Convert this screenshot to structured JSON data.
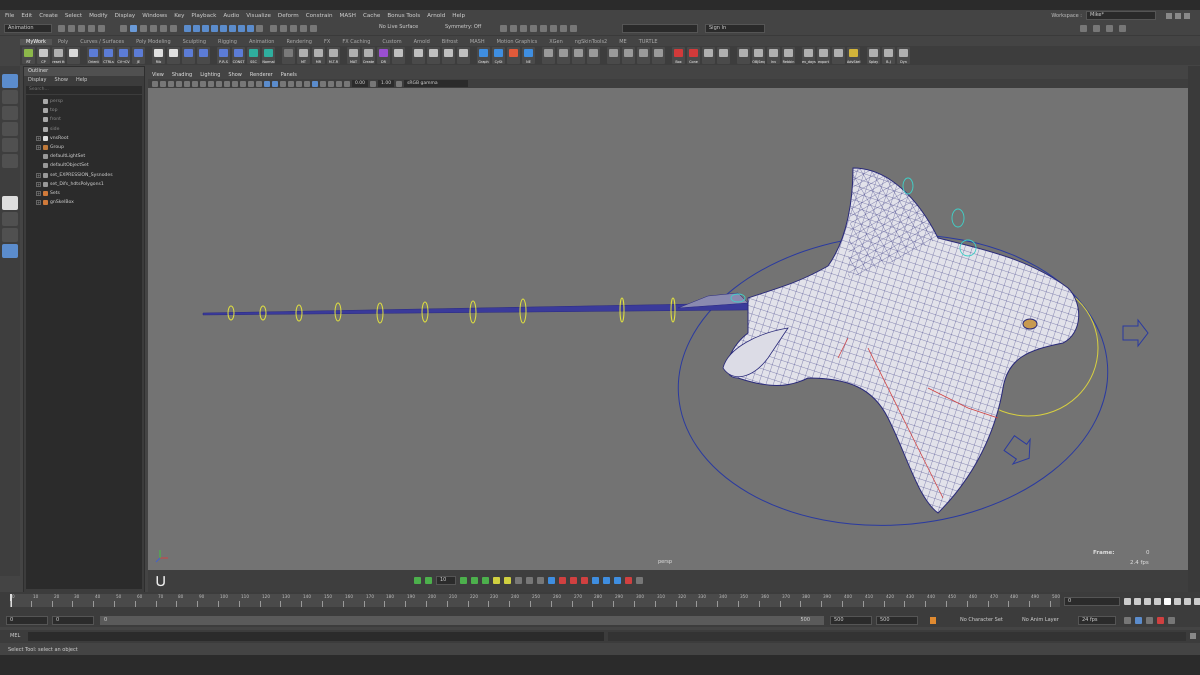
{
  "menubar": {
    "items": [
      "File",
      "Edit",
      "Create",
      "Select",
      "Modify",
      "Display",
      "Windows",
      "Key",
      "Playback",
      "Audio",
      "Visualize",
      "Deform",
      "Constrain",
      "MASH",
      "Cache",
      "Bonus Tools",
      "Arnold",
      "Help"
    ],
    "workspace_label": "Workspace :",
    "workspace_value": "Mike*"
  },
  "statusline": {
    "mode": "Animation",
    "live_surface": "No Live Surface",
    "symmetry": "Symmetry: Off",
    "sign_in": "Sign In"
  },
  "shelf": {
    "tabs": [
      "MyWork",
      "Poly",
      "Curves / Surfaces",
      "Poly Modeling",
      "Sculpting",
      "Rigging",
      "Animation",
      "Rendering",
      "FX",
      "FX Caching",
      "Custom",
      "Arnold",
      "Bifrost",
      "MASH",
      "Motion Graphics",
      "XGen",
      "ngSkinTools2",
      "ME",
      "TURTLE"
    ],
    "active_tab": "MyWork",
    "buttons": [
      {
        "label": "RT",
        "color": "#8cb84a"
      },
      {
        "label": "CP",
        "color": "#c8c8c8"
      },
      {
        "label": "reset tt",
        "color": "#b0b0b0"
      },
      {
        "label": "",
        "color": "#d9d9d9"
      },
      {
        "label": "Orient",
        "color": "#5c7cd6"
      },
      {
        "label": "CTRLs",
        "color": "#5c7cd6"
      },
      {
        "label": "CV→CV",
        "color": "#5c7cd6"
      },
      {
        "label": "JE",
        "color": "#5c7cd6"
      },
      {
        "label": "Rib",
        "color": "#e0e0e0"
      },
      {
        "label": "",
        "color": "#e0e0e0"
      },
      {
        "label": "",
        "color": "#5c7cd6"
      },
      {
        "label": "",
        "color": "#5c7cd6"
      },
      {
        "label": "P-R-S",
        "color": "#5c7cd6"
      },
      {
        "label": "CONST",
        "color": "#5c7cd6"
      },
      {
        "label": "SSC",
        "color": "#2fae9e"
      },
      {
        "label": "Normal",
        "color": "#2fae9e"
      },
      {
        "label": "",
        "color": "#7a7a7a"
      },
      {
        "label": "MT",
        "color": "#b0b0b0"
      },
      {
        "label": "MR",
        "color": "#b0b0b0"
      },
      {
        "label": "M-T-R",
        "color": "#b0b0b0"
      },
      {
        "label": "MAT",
        "color": "#b0b0b0"
      },
      {
        "label": "Create",
        "color": "#b0b0b0"
      },
      {
        "label": "DR",
        "color": "#9a4fd1"
      },
      {
        "label": "",
        "color": "#c0c0c0"
      },
      {
        "label": "",
        "color": "#c0c0c0"
      },
      {
        "label": "",
        "color": "#c0c0c0"
      },
      {
        "label": "",
        "color": "#c0c0c0"
      },
      {
        "label": "",
        "color": "#c0c0c0"
      },
      {
        "label": "Graph",
        "color": "#3f8ee0"
      },
      {
        "label": "CySt",
        "color": "#3f8ee0"
      },
      {
        "label": "",
        "color": "#e05a3a"
      },
      {
        "label": "NE",
        "color": "#3f8ee0"
      },
      {
        "label": "",
        "color": "#9a9a9a"
      },
      {
        "label": "",
        "color": "#9a9a9a"
      },
      {
        "label": "",
        "color": "#9a9a9a"
      },
      {
        "label": "",
        "color": "#9a9a9a"
      },
      {
        "label": "",
        "color": "#9a9a9a"
      },
      {
        "label": "",
        "color": "#9a9a9a"
      },
      {
        "label": "",
        "color": "#9a9a9a"
      },
      {
        "label": "",
        "color": "#9a9a9a"
      },
      {
        "label": "Box",
        "color": "#d23a3a"
      },
      {
        "label": "Cone",
        "color": "#d23a3a"
      },
      {
        "label": "",
        "color": "#b0b0b0"
      },
      {
        "label": "",
        "color": "#b0b0b0"
      },
      {
        "label": "",
        "color": "#b0b0b0"
      },
      {
        "label": "OBJSeq",
        "color": "#b0b0b0"
      },
      {
        "label": "Inv",
        "color": "#b0b0b0"
      },
      {
        "label": "Rebbin",
        "color": "#b0b0b0"
      },
      {
        "label": "ev_days",
        "color": "#b0b0b0"
      },
      {
        "label": "export",
        "color": "#b0b0b0"
      },
      {
        "label": "",
        "color": "#b0b0b0"
      },
      {
        "label": "AdvSkel",
        "color": "#d2b43a"
      },
      {
        "label": "Splay",
        "color": "#b0b0b0"
      },
      {
        "label": "B-J",
        "color": "#b0b0b0"
      },
      {
        "label": "Dyn",
        "color": "#b0b0b0"
      }
    ]
  },
  "outliner": {
    "title": "Outliner",
    "menu": [
      "Display",
      "Show",
      "Help"
    ],
    "search_placeholder": "Search...",
    "items": [
      {
        "label": "persp",
        "color": "#aaa",
        "exp": ""
      },
      {
        "label": "top",
        "color": "#aaa",
        "exp": ""
      },
      {
        "label": "front",
        "color": "#aaa",
        "exp": ""
      },
      {
        "label": "side",
        "color": "#aaa",
        "exp": ""
      },
      {
        "label": "vnsRoot",
        "color": "#ddd",
        "exp": "+"
      },
      {
        "label": "Group",
        "color": "#c07a3a",
        "exp": "+"
      },
      {
        "label": "defaultLightSet",
        "color": "#999",
        "exp": ""
      },
      {
        "label": "defaultObjectSet",
        "color": "#999",
        "exp": ""
      },
      {
        "label": "set_EXPRESSION_Sysnodes",
        "color": "#999",
        "exp": "+"
      },
      {
        "label": "set_Difs_hdtsPolygons1",
        "color": "#999",
        "exp": "+"
      },
      {
        "label": "Sets",
        "color": "#d07a3a",
        "exp": "+"
      },
      {
        "label": "gnSkelBox",
        "color": "#d07a3a",
        "exp": "+"
      }
    ]
  },
  "viewport": {
    "menu": [
      "View",
      "Shading",
      "Lighting",
      "Show",
      "Renderer",
      "Panels"
    ],
    "camera": "persp",
    "frame_label": "Frame:",
    "frame_value": "0",
    "fps": "2.4 fps",
    "field_1": "0.00",
    "field_2": "1.00",
    "colorspace": "sRGB gamma"
  },
  "timeline": {
    "ticks": [
      "0",
      "10",
      "20",
      "30",
      "40",
      "50",
      "60",
      "70",
      "80",
      "90",
      "100",
      "110",
      "120",
      "130",
      "140",
      "150",
      "160",
      "170",
      "180",
      "190",
      "200",
      "210",
      "220",
      "230",
      "240",
      "250",
      "260",
      "270",
      "280",
      "290",
      "300",
      "310",
      "320",
      "330",
      "340",
      "350",
      "360",
      "370",
      "380",
      "390",
      "400",
      "410",
      "420",
      "430",
      "440",
      "450",
      "460",
      "470",
      "480",
      "490",
      "500"
    ],
    "current_frame": "0",
    "range_start": "0",
    "range_start2": "0",
    "range_inner": "0",
    "range_inner_end": "500",
    "range_end": "500",
    "range_end2": "500",
    "character_set": "No Character Set",
    "anim_layer": "No Anim Layer",
    "fps": "24 fps",
    "playback_field": "10"
  },
  "commandline": {
    "label": "MEL"
  },
  "helpline": {
    "text": "Select Tool: select an object"
  }
}
